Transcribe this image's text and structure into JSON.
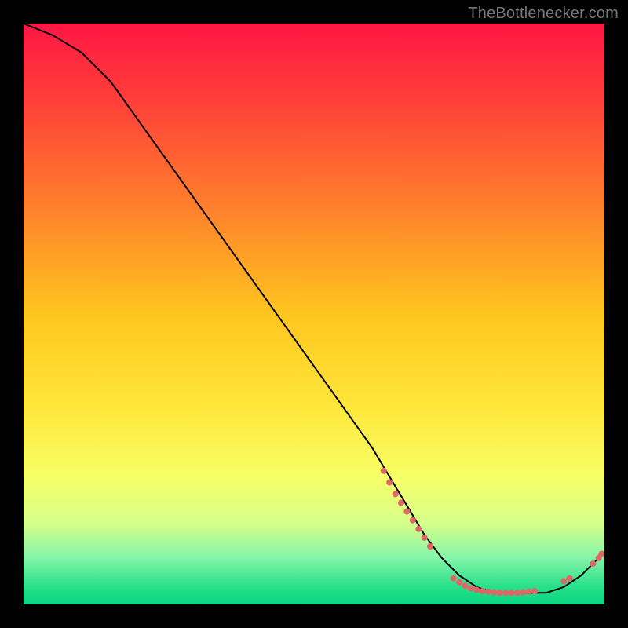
{
  "watermark": "TheBottlenecker.com",
  "chart_data": {
    "type": "line",
    "title": "",
    "xlabel": "",
    "ylabel": "",
    "xlim": [
      0,
      100
    ],
    "ylim": [
      0,
      100
    ],
    "grid": false,
    "gradient_stops": [
      {
        "offset": 0.0,
        "color": "#ff1744"
      },
      {
        "offset": 0.12,
        "color": "#ff3b3b"
      },
      {
        "offset": 0.3,
        "color": "#ff7a2d"
      },
      {
        "offset": 0.5,
        "color": "#ffc51f"
      },
      {
        "offset": 0.66,
        "color": "#ffe73a"
      },
      {
        "offset": 0.78,
        "color": "#f7ff66"
      },
      {
        "offset": 0.86,
        "color": "#d6ff8a"
      },
      {
        "offset": 0.92,
        "color": "#84f5a8"
      },
      {
        "offset": 0.97,
        "color": "#27e08a"
      },
      {
        "offset": 1.0,
        "color": "#0bd47f"
      }
    ],
    "series": [
      {
        "name": "bottleneck-curve",
        "x": [
          0,
          5,
          10,
          15,
          20,
          25,
          30,
          35,
          40,
          45,
          50,
          55,
          60,
          63,
          66,
          69,
          72,
          75,
          78,
          81,
          84,
          87,
          90,
          93,
          96,
          98,
          100
        ],
        "y": [
          100,
          98,
          95,
          90,
          83,
          76,
          69,
          62,
          55,
          48,
          41,
          34,
          27,
          22,
          17,
          12,
          8,
          5,
          3,
          2,
          2,
          2,
          2,
          3,
          5,
          7,
          9
        ]
      }
    ],
    "points": {
      "name": "sample-dots",
      "color": "#e06666",
      "radius": 4,
      "xy": [
        [
          62,
          23
        ],
        [
          63,
          21
        ],
        [
          64,
          19
        ],
        [
          65,
          17.5
        ],
        [
          66,
          16
        ],
        [
          67,
          14.5
        ],
        [
          68,
          13
        ],
        [
          69,
          11.5
        ],
        [
          70,
          10
        ],
        [
          74,
          4.5
        ],
        [
          75,
          3.8
        ],
        [
          76,
          3.2
        ],
        [
          77,
          2.8
        ],
        [
          78,
          2.5
        ],
        [
          79,
          2.3
        ],
        [
          80,
          2.2
        ],
        [
          81,
          2.1
        ],
        [
          82,
          2.0
        ],
        [
          83,
          2.0
        ],
        [
          84,
          2.0
        ],
        [
          85,
          2.0
        ],
        [
          86,
          2.1
        ],
        [
          87,
          2.2
        ],
        [
          88,
          2.3
        ],
        [
          93,
          4.0
        ],
        [
          94,
          4.5
        ],
        [
          98,
          7.0
        ],
        [
          99,
          8.0
        ],
        [
          99.5,
          8.7
        ]
      ]
    }
  }
}
